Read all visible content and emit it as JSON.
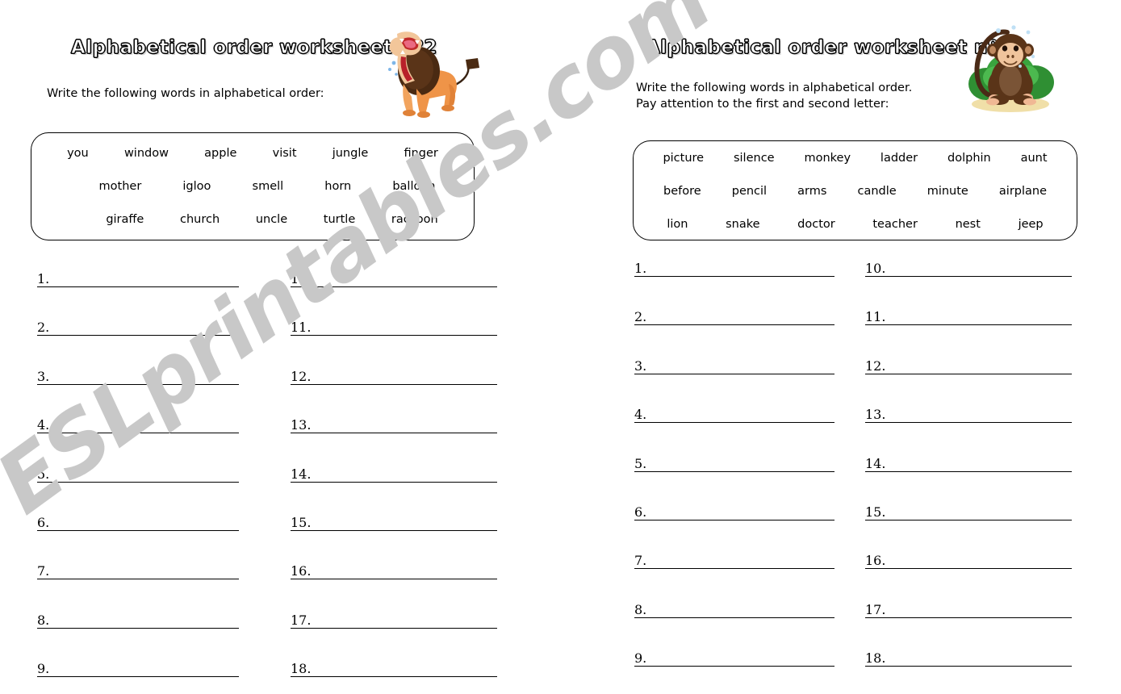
{
  "page": {
    "background_color": "#ffffff",
    "text_color": "#000000"
  },
  "watermark": {
    "text": "ESLprintables.com",
    "color": "#c8c8c8"
  },
  "worksheets": [
    {
      "id": "worksheet-2",
      "title": "Alphabetical order worksheet nº2",
      "instructions": "Write the following words in alphabetical order:",
      "clipart": "lion-icon",
      "word_bank": {
        "rows": [
          [
            "you",
            "window",
            "apple",
            "visit",
            "jungle",
            "finger"
          ],
          [
            "mother",
            "igloo",
            "smell",
            "horn",
            "balloon"
          ],
          [
            "giraffe",
            "church",
            "uncle",
            "turtle",
            "raccoon"
          ]
        ]
      },
      "answer_columns": [
        [
          "1.",
          "2.",
          "3.",
          "4.",
          "5.",
          "6.",
          "7.",
          "8.",
          "9."
        ],
        [
          "10.",
          "11.",
          "12.",
          "13.",
          "14.",
          "15.",
          "16.",
          "17.",
          "18."
        ]
      ]
    },
    {
      "id": "worksheet-3",
      "title": "Alphabetical order worksheet nº3",
      "instructions": "Write the following words in alphabetical order.\nPay attention to the first and second letter:",
      "clipart": "monkey-icon",
      "word_bank": {
        "rows": [
          [
            "picture",
            "silence",
            "monkey",
            "ladder",
            "dolphin",
            "aunt"
          ],
          [
            "before",
            "pencil",
            "arms",
            "candle",
            "minute",
            "airplane"
          ],
          [
            "lion",
            "snake",
            "doctor",
            "teacher",
            "nest",
            "jeep"
          ]
        ]
      },
      "answer_columns": [
        [
          "1.",
          "2.",
          "3.",
          "4.",
          "5.",
          "6.",
          "7.",
          "8.",
          "9."
        ],
        [
          "10.",
          "11.",
          "12.",
          "13.",
          "14.",
          "15.",
          "16.",
          "17.",
          "18."
        ]
      ]
    }
  ]
}
